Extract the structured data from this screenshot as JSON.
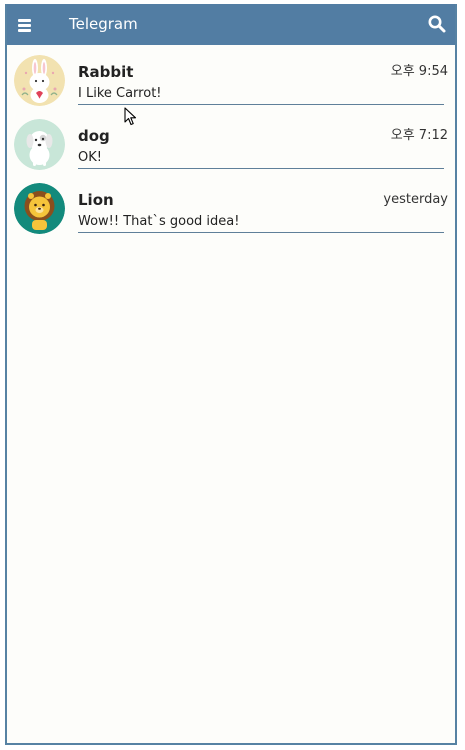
{
  "header": {
    "title": "Telegram",
    "menu_icon": "hamburger-menu-icon",
    "search_icon": "search-icon",
    "background_color": "#527da3"
  },
  "chats": [
    {
      "name": "Rabbit",
      "time": "오후 9:54",
      "preview": "I Like Carrot!",
      "avatar_icon": "rabbit-avatar",
      "avatar_color": "#f2e2b0"
    },
    {
      "name": "dog",
      "time": "오후 7:12",
      "preview": "OK!",
      "avatar_icon": "dog-avatar",
      "avatar_color": "#c8e6d8"
    },
    {
      "name": "Lion",
      "time": "yesterday",
      "preview": "Wow!! That`s good idea!",
      "avatar_icon": "lion-avatar",
      "avatar_color": "#138a7c"
    }
  ]
}
